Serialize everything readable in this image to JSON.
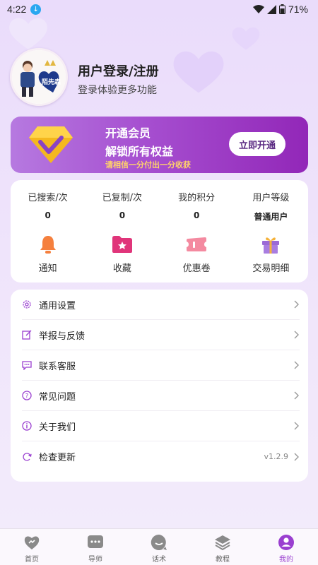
{
  "status_bar": {
    "time": "4:22",
    "battery": "71%"
  },
  "profile": {
    "title": "用户登录/注册",
    "subtitle": "登录体验更多功能",
    "avatar_caption": "陌先森"
  },
  "vip": {
    "line1": "开通会员",
    "line2": "解锁所有权益",
    "line3": "请相信一分付出一分收获",
    "button": "立即开通"
  },
  "stats": [
    {
      "label": "已搜索/次",
      "value": "0"
    },
    {
      "label": "已复制/次",
      "value": "0"
    },
    {
      "label": "我的积分",
      "value": "0"
    },
    {
      "label": "用户等级",
      "value": "普通用户"
    }
  ],
  "shortcuts": [
    {
      "label": "通知",
      "icon": "bell-icon"
    },
    {
      "label": "收藏",
      "icon": "star-folder-icon"
    },
    {
      "label": "优惠卷",
      "icon": "ticket-icon"
    },
    {
      "label": "交易明细",
      "icon": "gift-icon"
    }
  ],
  "menu": [
    {
      "label": "通用设置",
      "icon": "gear-icon",
      "value": ""
    },
    {
      "label": "举报与反馈",
      "icon": "edit-icon",
      "value": ""
    },
    {
      "label": "联系客服",
      "icon": "chat-icon",
      "value": ""
    },
    {
      "label": "常见问题",
      "icon": "question-icon",
      "value": ""
    },
    {
      "label": "关于我们",
      "icon": "info-icon",
      "value": ""
    },
    {
      "label": "检查更新",
      "icon": "refresh-icon",
      "value": "v1.2.9"
    }
  ],
  "tabs": [
    {
      "label": "首页",
      "icon": "home-heart-icon",
      "active": false
    },
    {
      "label": "导师",
      "icon": "message-icon",
      "active": false
    },
    {
      "label": "话术",
      "icon": "chat-bubble-icon",
      "active": false
    },
    {
      "label": "教程",
      "icon": "layers-icon",
      "active": false
    },
    {
      "label": "我的",
      "icon": "user-icon",
      "active": true
    }
  ],
  "colors": {
    "accent": "#9a3fd0",
    "vip_gold": "#ffd36a",
    "tab_inactive": "#666666"
  }
}
